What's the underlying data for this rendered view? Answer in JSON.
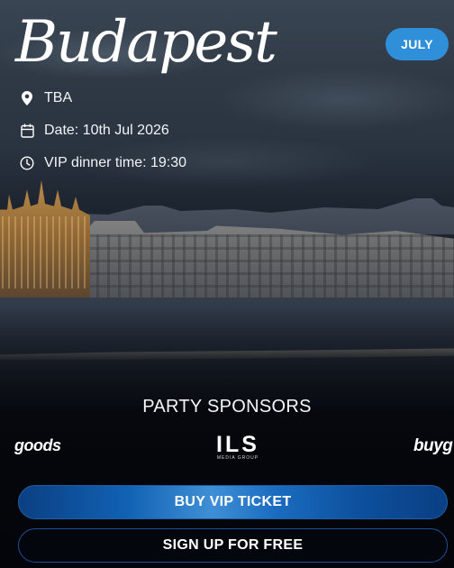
{
  "event": {
    "city": "Budapest",
    "month_badge": "JULY",
    "location": "TBA",
    "date": "Date: 10th Jul 2026",
    "vip_dinner": "VIP dinner time: 19:30"
  },
  "icons": {
    "location": "location-pin-icon",
    "date": "calendar-icon",
    "time": "clock-icon"
  },
  "sponsors": {
    "title": "PARTY SPONSORS",
    "logos": [
      {
        "text": "goods"
      },
      {
        "text": "ILS",
        "subtext": "MEDIA GROUP"
      },
      {
        "text": "buyg"
      }
    ]
  },
  "actions": {
    "vip_ticket": "BUY VIP TICKET",
    "sign_up": "SIGN UP FOR FREE"
  },
  "colors": {
    "accent": "#2f8fd8",
    "button_blue": "#1161b3",
    "background": "#05070d"
  }
}
